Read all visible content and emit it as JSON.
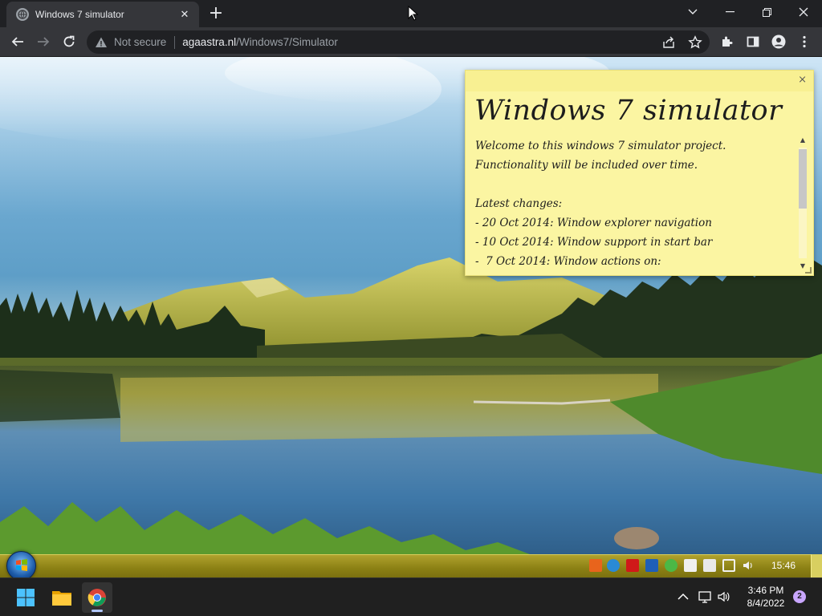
{
  "browser": {
    "tab": {
      "title": "Windows 7 simulator",
      "favicon": "globe-icon"
    },
    "address": {
      "security_label": "Not secure",
      "host": "agaastra.nl",
      "path": "/Windows7/Simulator"
    }
  },
  "sticky_note": {
    "title": "Windows 7 simulator",
    "close": "×",
    "lines": [
      "Welcome to this windows 7 simulator project.",
      "Functionality will be included over time.",
      "",
      "Latest changes:",
      "- 20 Oct 2014: Window explorer navigation",
      "- 10 Oct 2014: Window support in start bar",
      "-  7 Oct 2014: Window actions on:"
    ]
  },
  "win7_taskbar": {
    "clock": "15:46",
    "tray_icons": [
      "orange-app-icon",
      "ie-icon",
      "pdf-icon",
      "outlook-icon",
      "green-check-icon",
      "flag-icon",
      "clipboard-icon",
      "network-icon",
      "volume-icon"
    ],
    "colors": {
      "bar": "#8b8014",
      "start_orb": "#1c5aa8"
    }
  },
  "host_taskbar": {
    "apps": [
      "windows-start-icon",
      "file-explorer-icon",
      "chrome-icon"
    ],
    "time": "3:46 PM",
    "date": "8/4/2022",
    "notifications": "2"
  },
  "colors": {
    "chrome_dark": "#202124",
    "chrome_toolbar": "#35363a",
    "note_yellow": "#fbf5a2"
  }
}
